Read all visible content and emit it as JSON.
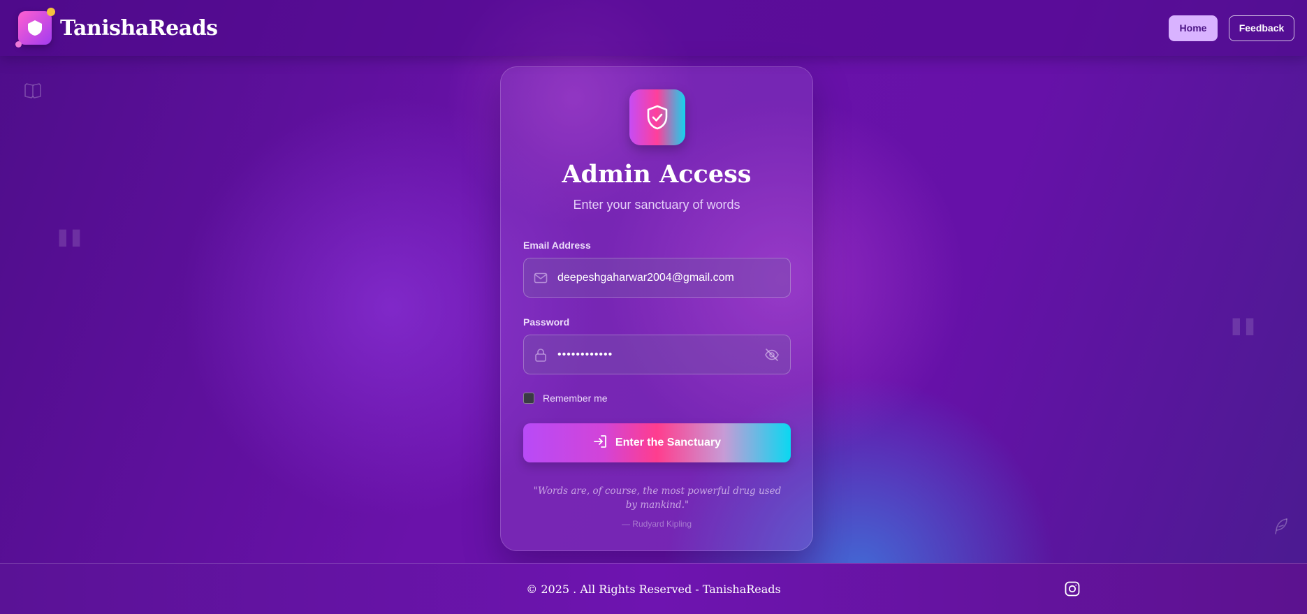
{
  "header": {
    "brand": "TanishaReads",
    "nav": {
      "home_label": "Home",
      "feedback_label": "Feedback"
    }
  },
  "login": {
    "title": "Admin Access",
    "subtitle": "Enter your sanctuary of words",
    "email_label": "Email Address",
    "email_value": "deepeshgaharwar2004@gmail.com",
    "password_label": "Password",
    "password_value": "••••••••••••",
    "remember_label": "Remember me",
    "remember_checked": false,
    "submit_label": "Enter the Sanctuary",
    "quote": "\"Words are, of course, the most powerful drug used by mankind.\"",
    "quote_author": "— Rudyard Kipling"
  },
  "footer": {
    "copyright": "© 2025 . All Rights Reserved - TanishaReads"
  },
  "icons": {
    "logo": "shield-logo-icon",
    "shield": "shield-check-icon",
    "email": "envelope-icon",
    "password": "lock-icon",
    "toggle_password": "eye-off-icon",
    "submit": "login-icon",
    "social": "instagram-icon",
    "decor": [
      "open-book-icon",
      "quote-icon",
      "feather-icon"
    ]
  },
  "colors": {
    "accent_gradient": [
      "#b84bf7",
      "#ff3d8e",
      "#0ad8f1"
    ],
    "home_button_bg": "#d9b3ff",
    "background": "#5b1196"
  }
}
